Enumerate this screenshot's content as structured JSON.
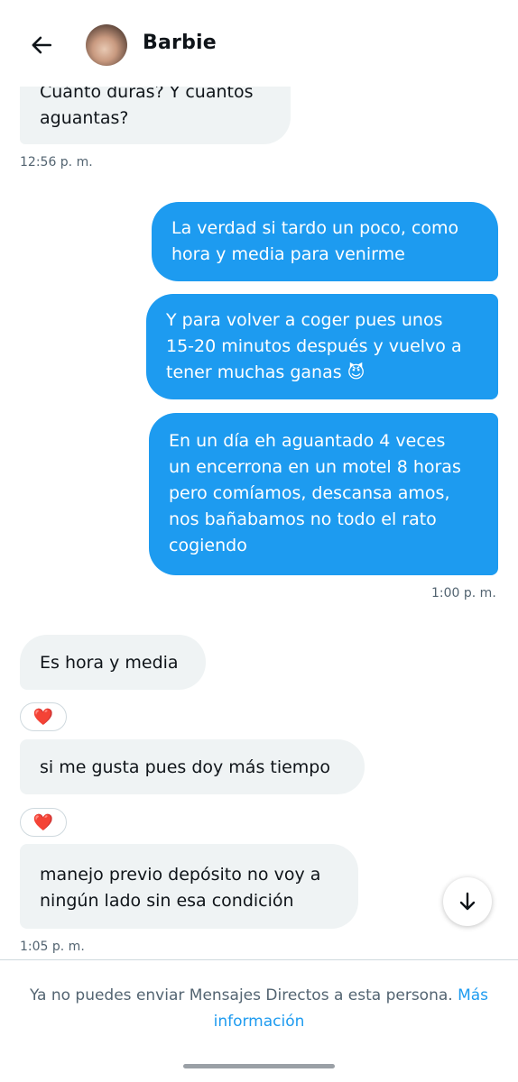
{
  "header": {
    "back_icon": "arrow-left-icon",
    "contact_name": "Barbie"
  },
  "messages": [
    {
      "direction": "incoming",
      "text": "Cuánto duras? Y cuantos\naguantas?"
    },
    {
      "direction": "outgoing",
      "text": "La verdad si tardo un poco, como\nhora y media para venirme"
    },
    {
      "direction": "outgoing",
      "text": "Y para volver a coger pues unos\n15-20 minutos después y vuelvo a\ntener muchas ganas 😈"
    },
    {
      "direction": "outgoing",
      "text": "En un día eh aguantado 4 veces\nun encerrona en un motel 8 horas\npero comíamos, descansa amos,\nnos bañabamos no todo el rato\ncogiendo"
    },
    {
      "direction": "incoming",
      "text": "Es hora y media",
      "reaction": "❤️"
    },
    {
      "direction": "incoming",
      "text": "si me gusta pues doy más tiempo",
      "reaction": "❤️"
    },
    {
      "direction": "incoming",
      "text": "manejo previo depósito no voy a\nningún lado sin esa condición"
    }
  ],
  "timestamps": [
    "12:56 p. m.",
    "1:00 p. m.",
    "1:05 p. m."
  ],
  "scroll_button_icon": "arrow-down-icon",
  "footer": {
    "notice": "Ya no puedes enviar Mensajes Directos a esta persona. ",
    "link": "Más información"
  },
  "colors": {
    "outgoing_bubble": "#1d9bf0",
    "incoming_bubble": "#eff3f4",
    "link": "#1d9bf0",
    "muted_text": "#536471"
  }
}
